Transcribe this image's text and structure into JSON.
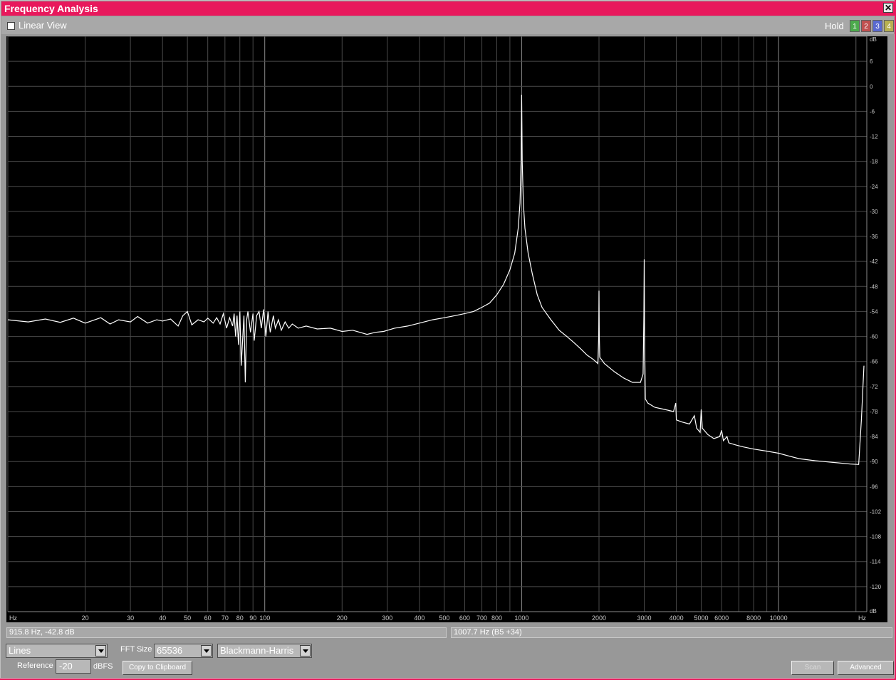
{
  "window": {
    "title": "Frequency Analysis",
    "close_glyph": "✕"
  },
  "toolbar": {
    "linear_view_label": "Linear View",
    "linear_view_checked": false,
    "hold_label": "Hold",
    "hold_buttons": [
      {
        "label": "1",
        "color": "#4caa4c"
      },
      {
        "label": "2",
        "color": "#c05050"
      },
      {
        "label": "3",
        "color": "#5a6ad0"
      },
      {
        "label": "4",
        "color": "#b8b050"
      }
    ]
  },
  "chart_data": {
    "type": "line",
    "xscale": "log",
    "xlim": [
      10,
      22050
    ],
    "ylim": [
      -126,
      12
    ],
    "grid": true,
    "trace_color": "#ffffff",
    "x_unit_label": "Hz",
    "y_unit_label": "dB",
    "x_ticks": [
      {
        "value": 20,
        "label": "20"
      },
      {
        "value": 30,
        "label": "30"
      },
      {
        "value": 40,
        "label": "40"
      },
      {
        "value": 50,
        "label": "50"
      },
      {
        "value": 60,
        "label": "60"
      },
      {
        "value": 70,
        "label": "70"
      },
      {
        "value": 80,
        "label": "80"
      },
      {
        "value": 90,
        "label": "90"
      },
      {
        "value": 100,
        "label": "100"
      },
      {
        "value": 200,
        "label": "200"
      },
      {
        "value": 300,
        "label": "300"
      },
      {
        "value": 400,
        "label": "400"
      },
      {
        "value": 500,
        "label": "500"
      },
      {
        "value": 600,
        "label": "600"
      },
      {
        "value": 700,
        "label": "700"
      },
      {
        "value": 800,
        "label": "800"
      },
      {
        "value": 1000,
        "label": "1000"
      },
      {
        "value": 2000,
        "label": "2000"
      },
      {
        "value": 3000,
        "label": "3000"
      },
      {
        "value": 4000,
        "label": "4000"
      },
      {
        "value": 5000,
        "label": "5000"
      },
      {
        "value": 6000,
        "label": "6000"
      },
      {
        "value": 8000,
        "label": "8000"
      },
      {
        "value": 10000,
        "label": "10000"
      }
    ],
    "y_ticks": [
      {
        "value": 6,
        "label": "6"
      },
      {
        "value": 0,
        "label": "0"
      },
      {
        "value": -6,
        "label": "-6"
      },
      {
        "value": -12,
        "label": "-12"
      },
      {
        "value": -18,
        "label": "-18"
      },
      {
        "value": -24,
        "label": "-24"
      },
      {
        "value": -30,
        "label": "-30"
      },
      {
        "value": -36,
        "label": "-36"
      },
      {
        "value": -42,
        "label": "-42"
      },
      {
        "value": -48,
        "label": "-48"
      },
      {
        "value": -54,
        "label": "-54"
      },
      {
        "value": -60,
        "label": "-60"
      },
      {
        "value": -66,
        "label": "-66"
      },
      {
        "value": -72,
        "label": "-72"
      },
      {
        "value": -78,
        "label": "-78"
      },
      {
        "value": -84,
        "label": "-84"
      },
      {
        "value": -90,
        "label": "-90"
      },
      {
        "value": -96,
        "label": "-96"
      },
      {
        "value": -102,
        "label": "-102"
      },
      {
        "value": -108,
        "label": "-108"
      },
      {
        "value": -114,
        "label": "-114"
      },
      {
        "value": -120,
        "label": "-120"
      }
    ],
    "series": [
      {
        "points": [
          [
            10,
            -56
          ],
          [
            12,
            -56.5
          ],
          [
            14,
            -55.8
          ],
          [
            16,
            -56.6
          ],
          [
            18,
            -55.6
          ],
          [
            20,
            -56.8
          ],
          [
            23,
            -55.5
          ],
          [
            25,
            -57
          ],
          [
            27,
            -56
          ],
          [
            30,
            -56.5
          ],
          [
            32,
            -55.2
          ],
          [
            35,
            -56.8
          ],
          [
            38,
            -56
          ],
          [
            40,
            -56.3
          ],
          [
            43,
            -55.8
          ],
          [
            46,
            -57.5
          ],
          [
            48,
            -55
          ],
          [
            50,
            -54
          ],
          [
            52,
            -57.2
          ],
          [
            55,
            -56
          ],
          [
            58,
            -56.5
          ],
          [
            60,
            -55.6
          ],
          [
            63,
            -56.8
          ],
          [
            65,
            -55.5
          ],
          [
            67,
            -57
          ],
          [
            69,
            -54.5
          ],
          [
            71,
            -58
          ],
          [
            73,
            -55.5
          ],
          [
            75,
            -57.5
          ],
          [
            76,
            -54.5
          ],
          [
            77,
            -60
          ],
          [
            78,
            -55
          ],
          [
            79,
            -62
          ],
          [
            80,
            -54
          ],
          [
            81,
            -67
          ],
          [
            82,
            -61
          ],
          [
            83,
            -55
          ],
          [
            84,
            -71
          ],
          [
            85,
            -56
          ],
          [
            86,
            -54
          ],
          [
            88,
            -59
          ],
          [
            90,
            -54.5
          ],
          [
            91,
            -61
          ],
          [
            92,
            -58
          ],
          [
            93,
            -55
          ],
          [
            95,
            -54
          ],
          [
            97,
            -58
          ],
          [
            99,
            -53.5
          ],
          [
            101,
            -60
          ],
          [
            103,
            -54
          ],
          [
            105,
            -59
          ],
          [
            108,
            -55
          ],
          [
            110,
            -58
          ],
          [
            113,
            -56
          ],
          [
            116,
            -58.5
          ],
          [
            120,
            -56.5
          ],
          [
            124,
            -58
          ],
          [
            128,
            -57
          ],
          [
            135,
            -58
          ],
          [
            145,
            -57.5
          ],
          [
            160,
            -58.2
          ],
          [
            180,
            -58
          ],
          [
            200,
            -58.8
          ],
          [
            220,
            -58.5
          ],
          [
            250,
            -59.5
          ],
          [
            270,
            -59
          ],
          [
            290,
            -58.8
          ],
          [
            320,
            -58
          ],
          [
            360,
            -57.5
          ],
          [
            400,
            -56.8
          ],
          [
            450,
            -56
          ],
          [
            500,
            -55.5
          ],
          [
            550,
            -55
          ],
          [
            600,
            -54.5
          ],
          [
            650,
            -54
          ],
          [
            700,
            -53
          ],
          [
            750,
            -52
          ],
          [
            800,
            -50
          ],
          [
            850,
            -47.5
          ],
          [
            900,
            -44
          ],
          [
            940,
            -40
          ],
          [
            970,
            -34
          ],
          [
            985,
            -28
          ],
          [
            995,
            -18
          ],
          [
            1000,
            -2
          ],
          [
            1005,
            -18
          ],
          [
            1015,
            -28
          ],
          [
            1030,
            -34
          ],
          [
            1060,
            -40
          ],
          [
            1100,
            -45
          ],
          [
            1150,
            -50
          ],
          [
            1200,
            -53
          ],
          [
            1300,
            -56
          ],
          [
            1400,
            -58.5
          ],
          [
            1500,
            -60
          ],
          [
            1600,
            -61.5
          ],
          [
            1700,
            -63
          ],
          [
            1800,
            -64.5
          ],
          [
            1900,
            -65.5
          ],
          [
            1980,
            -66.5
          ],
          [
            1995,
            -60
          ],
          [
            2000,
            -49
          ],
          [
            2005,
            -60
          ],
          [
            2015,
            -65
          ],
          [
            2100,
            -66.5
          ],
          [
            2300,
            -68.5
          ],
          [
            2500,
            -70
          ],
          [
            2700,
            -71
          ],
          [
            2900,
            -71
          ],
          [
            2970,
            -69
          ],
          [
            2990,
            -55
          ],
          [
            3000,
            -41.5
          ],
          [
            3010,
            -60
          ],
          [
            3030,
            -75
          ],
          [
            3100,
            -76
          ],
          [
            3300,
            -77
          ],
          [
            3600,
            -77.5
          ],
          [
            3900,
            -78
          ],
          [
            3980,
            -76
          ],
          [
            4000,
            -80
          ],
          [
            4200,
            -80.5
          ],
          [
            4500,
            -81
          ],
          [
            4700,
            -79
          ],
          [
            4800,
            -82
          ],
          [
            4950,
            -83
          ],
          [
            5000,
            -77.5
          ],
          [
            5050,
            -82
          ],
          [
            5300,
            -83.5
          ],
          [
            5600,
            -84.5
          ],
          [
            5900,
            -84
          ],
          [
            6000,
            -82.5
          ],
          [
            6100,
            -85
          ],
          [
            6300,
            -84
          ],
          [
            6400,
            -85.5
          ],
          [
            6800,
            -86
          ],
          [
            7300,
            -86.5
          ],
          [
            8000,
            -87
          ],
          [
            9000,
            -87.5
          ],
          [
            10000,
            -88
          ],
          [
            11000,
            -88.7
          ],
          [
            12000,
            -89.3
          ],
          [
            13500,
            -89.7
          ],
          [
            15000,
            -90
          ],
          [
            17000,
            -90.3
          ],
          [
            19000,
            -90.6
          ],
          [
            20500,
            -90.7
          ],
          [
            21000,
            -80
          ],
          [
            21500,
            -67
          ]
        ]
      }
    ]
  },
  "status": {
    "cursor_readout": "915.8 Hz,  -42.8 dB",
    "peak_readout": "1007.7 Hz (B5 +34)"
  },
  "controls": {
    "display_mode": "Lines",
    "fft_size_label": "FFT Size",
    "fft_size_value": "65536",
    "window_function": "Blackmann-Harris",
    "reference_label": "Reference",
    "reference_value": "-20",
    "reference_unit": "dBFS",
    "copy_button": "Copy to Clipboard",
    "scan_button": "Scan",
    "advanced_button": "Advanced"
  }
}
